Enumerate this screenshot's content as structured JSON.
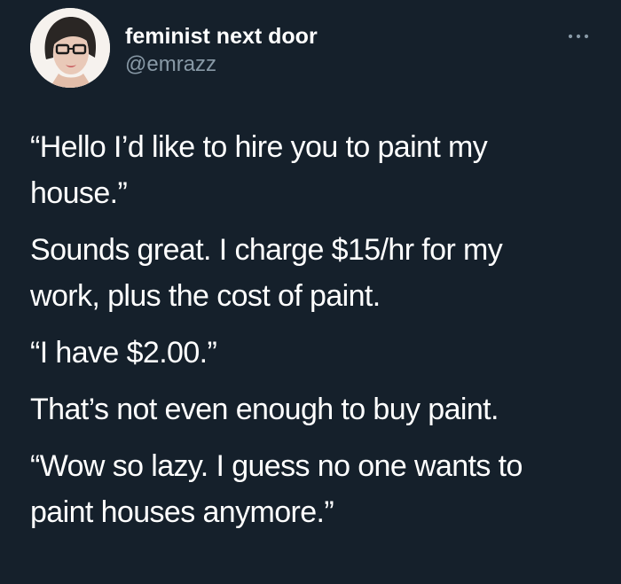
{
  "tweet": {
    "author": {
      "display_name": "feminist next door",
      "handle": "@emrazz",
      "avatar_icon": "profile-photo-avatar"
    },
    "more_icon": "ellipsis-icon",
    "paragraphs": [
      "“Hello I’d like to hire you to paint my\nhouse.”",
      "Sounds great. I charge $15/hr for my\nwork, plus the cost of paint.",
      "“I have $2.00.”",
      "That’s not even enough to buy paint.",
      "“Wow so lazy. I guess no one wants to\npaint houses anymore.”"
    ]
  },
  "colors": {
    "background": "#15202b",
    "text": "#ffffff",
    "secondary_text": "#8899a6"
  }
}
